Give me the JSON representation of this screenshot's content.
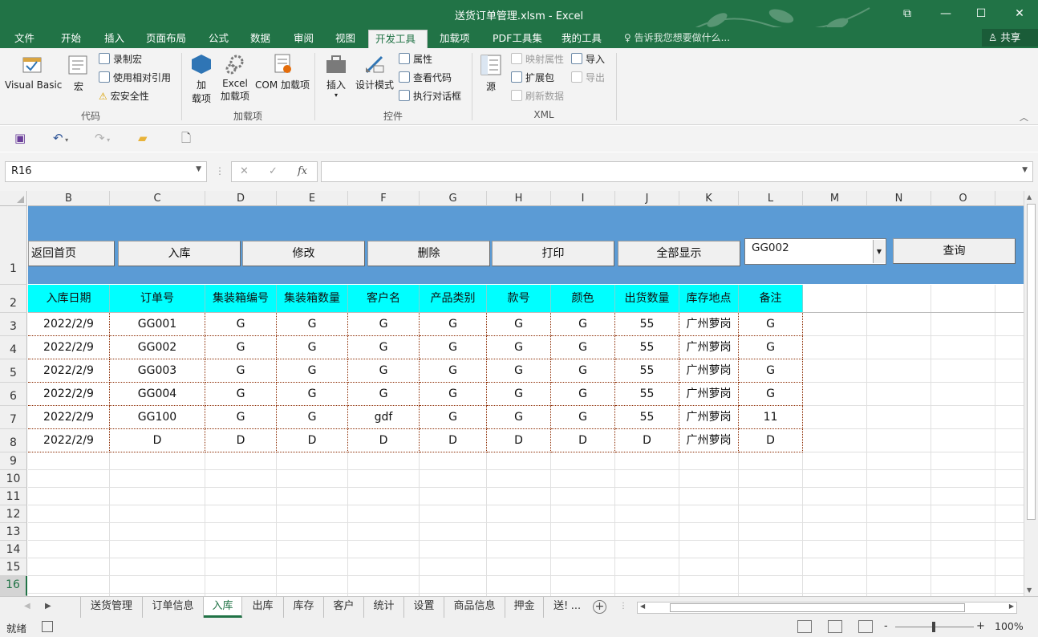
{
  "window": {
    "title": "送货订单管理.xlsm - Excel",
    "controls": [
      "⧉",
      "—",
      "☐",
      "✕"
    ]
  },
  "ribbon_tabs": [
    "文件",
    "开始",
    "插入",
    "页面布局",
    "公式",
    "数据",
    "审阅",
    "视图",
    "开发工具",
    "加载项",
    "PDF工具集",
    "我的工具"
  ],
  "active_ribbon_tab": "开发工具",
  "tell_me": "告诉我您想要做什么...",
  "share": "共享",
  "ribbon": {
    "code": {
      "label": "代码",
      "visual_basic": "Visual Basic",
      "macros": "宏",
      "record_macro": "录制宏",
      "use_relative": "使用相对引用",
      "macro_security": "宏安全性"
    },
    "addins": {
      "label": "加载项",
      "addins_btn_1": "加",
      "addins_btn_2": "载项",
      "excel_addins_1": "Excel",
      "excel_addins_2": "加载项",
      "com_addins": "COM 加载项"
    },
    "controls": {
      "label": "控件",
      "insert": "插入",
      "design_mode": "设计模式",
      "properties": "属性",
      "view_code": "查看代码",
      "run_dialog": "执行对话框"
    },
    "xml": {
      "label": "XML",
      "source": "源",
      "map_properties": "映射属性",
      "expansion_packs": "扩展包",
      "refresh_data": "刷新数据",
      "import": "导入",
      "export": "导出"
    }
  },
  "name_box": "R16",
  "formula": "",
  "columns": [
    "B",
    "C",
    "D",
    "E",
    "F",
    "G",
    "H",
    "I",
    "J",
    "K",
    "L",
    "M",
    "N",
    "O"
  ],
  "rows": [
    "1",
    "2",
    "3",
    "4",
    "5",
    "6",
    "7",
    "8",
    "9",
    "10",
    "11",
    "12",
    "13",
    "14",
    "15",
    "16"
  ],
  "sheet_buttons": {
    "home": "返回首页",
    "stock_in": "入库",
    "modify": "修改",
    "delete": "删除",
    "print": "打印",
    "show_all": "全部显示",
    "query": "查询"
  },
  "order_combo": "GG002",
  "table": {
    "headers": [
      "入库日期",
      "订单号",
      "集装箱编号",
      "集装箱数量",
      "客户名",
      "产品类别",
      "款号",
      "颜色",
      "出货数量",
      "库存地点",
      "备注"
    ],
    "rows": [
      [
        "2022/2/9",
        "GG001",
        "G",
        "G",
        "G",
        "G",
        "G",
        "G",
        "55",
        "广州萝岗",
        "G"
      ],
      [
        "2022/2/9",
        "GG002",
        "G",
        "G",
        "G",
        "G",
        "G",
        "G",
        "55",
        "广州萝岗",
        "G"
      ],
      [
        "2022/2/9",
        "GG003",
        "G",
        "G",
        "G",
        "G",
        "G",
        "G",
        "55",
        "广州萝岗",
        "G"
      ],
      [
        "2022/2/9",
        "GG004",
        "G",
        "G",
        "G",
        "G",
        "G",
        "G",
        "55",
        "广州萝岗",
        "G"
      ],
      [
        "2022/2/9",
        "GG100",
        "G",
        "G",
        "gdf",
        "G",
        "G",
        "G",
        "55",
        "广州萝岗",
        "11"
      ],
      [
        "2022/2/9",
        "D",
        "D",
        "D",
        "D",
        "D",
        "D",
        "D",
        "D",
        "广州萝岗",
        "D"
      ]
    ]
  },
  "sheet_tabs": [
    "送货管理",
    "订单信息",
    "入库",
    "出库",
    "库存",
    "客户",
    "统计",
    "设置",
    "商品信息",
    "押金",
    "送!"
  ],
  "active_sheet": "入库",
  "sheet_more": "...",
  "status": {
    "ready": "就绪",
    "zoom": "100%",
    "zoom_minus": "-",
    "zoom_plus": "+"
  },
  "colors": {
    "excel_green": "#217346",
    "band_blue": "#5b9bd5",
    "header_cyan": "#00ffff"
  }
}
